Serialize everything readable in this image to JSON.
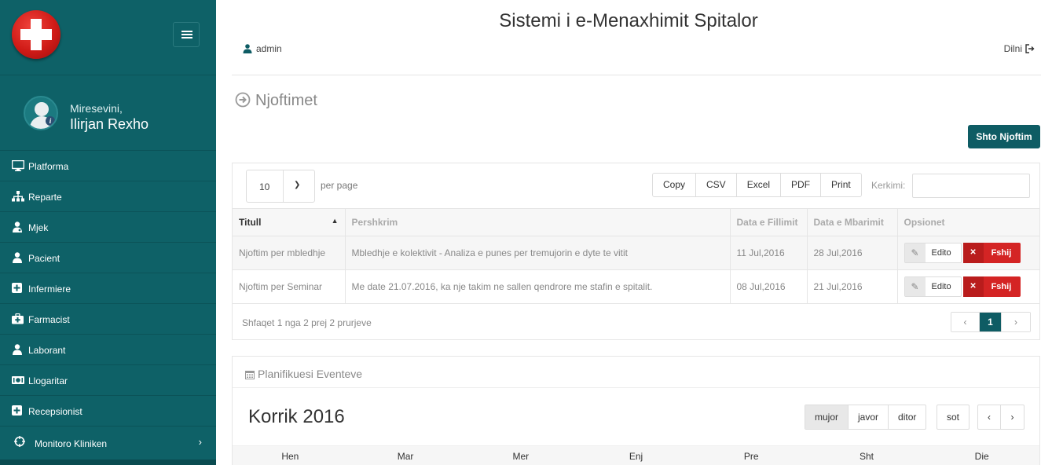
{
  "app": {
    "title": "Sistemi i e-Menaxhimit Spitalor"
  },
  "header": {
    "user": "admin",
    "logout": "Dilni"
  },
  "sidebar": {
    "welcome": "Miresevini,",
    "username": "Ilirjan Rexho",
    "items": [
      {
        "label": "Platforma",
        "icon": "monitor-icon"
      },
      {
        "label": "Reparte",
        "icon": "sitemap-icon"
      },
      {
        "label": "Mjek",
        "icon": "doctor-icon"
      },
      {
        "label": "Pacient",
        "icon": "user-icon"
      },
      {
        "label": "Infermiere",
        "icon": "plus-square-icon"
      },
      {
        "label": "Farmacist",
        "icon": "medkit-icon"
      },
      {
        "label": "Laborant",
        "icon": "user-icon"
      },
      {
        "label": "Llogaritar",
        "icon": "money-icon"
      },
      {
        "label": "Recepsionist",
        "icon": "plus-square-icon"
      },
      {
        "label": "Monitoro Kliniken",
        "icon": "crosshair-icon"
      }
    ]
  },
  "page": {
    "heading": "Njoftimet",
    "add_button": "Shto Njoftim"
  },
  "table": {
    "per_page_value": "10",
    "per_page_label": "per page",
    "export_buttons": [
      "Copy",
      "CSV",
      "Excel",
      "PDF",
      "Print"
    ],
    "search_label": "Kerkimi:",
    "search_value": "",
    "columns": [
      "Titull",
      "Pershkrim",
      "Data e Fillimit",
      "Data e Mbarimit",
      "Opsionet"
    ],
    "rows": [
      {
        "title": "Njoftim per mbledhje",
        "description": "Mbledhje e kolektivit - Analiza e punes per tremujorin e dyte te vitit",
        "start": "11 Jul,2016",
        "end": "28 Jul,2016"
      },
      {
        "title": "Njoftim per Seminar",
        "description": "Me date 21.07.2016, ka nje takim ne sallen qendrore me stafin e spitalit.",
        "start": "08 Jul,2016",
        "end": "21 Jul,2016"
      }
    ],
    "edit_label": "Edito",
    "delete_label": "Fshij",
    "summary": "Shfaqet 1 nga 2 prej 2 prurjeve",
    "pager": {
      "prev": "‹",
      "current": "1",
      "next": "›"
    }
  },
  "calendar": {
    "title": "Planifikuesi Eventeve",
    "month": "Korrik 2016",
    "views": [
      "mujor",
      "javor",
      "ditor"
    ],
    "active_view": "mujor",
    "today": "sot",
    "prev": "‹",
    "next": "›",
    "days": [
      "Hen",
      "Mar",
      "Mer",
      "Enj",
      "Pre",
      "Sht",
      "Die"
    ]
  },
  "colors": {
    "sidebar": "#0e6167",
    "primary": "#0e5c64",
    "danger": "#d42424"
  }
}
